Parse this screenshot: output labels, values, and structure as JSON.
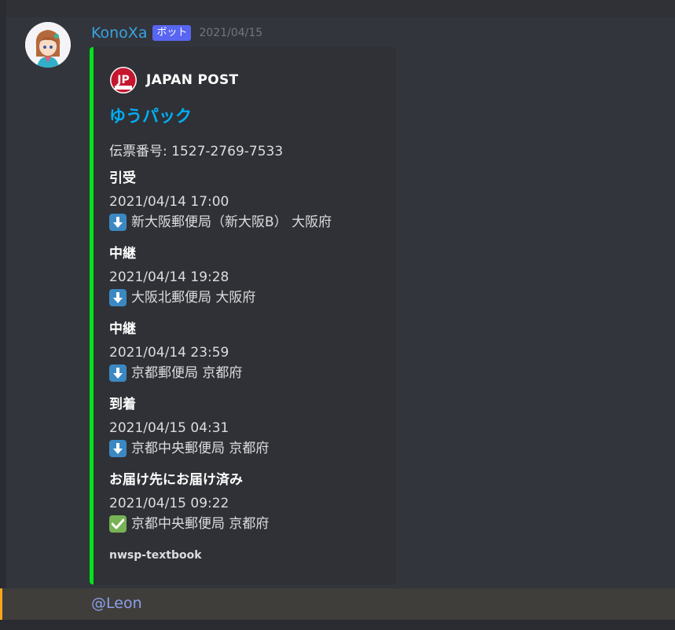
{
  "message": {
    "username": "KonoXa",
    "bot_tag": "ボット",
    "timestamp": "2021/04/15"
  },
  "embed": {
    "accent_color": "#00e41a",
    "author": "JAPAN POST",
    "author_logo_text": "JP",
    "title": "ゆうパック",
    "tracking_line": "伝票番号: 1527-2769-7533",
    "events": [
      {
        "status": "引受",
        "time": "2021/04/14 17:00",
        "icon": "down-arrow-emoji",
        "place": "新大阪郵便局（新大阪B） 大阪府"
      },
      {
        "status": "中継",
        "time": "2021/04/14 19:28",
        "icon": "down-arrow-emoji",
        "place": "大阪北郵便局 大阪府"
      },
      {
        "status": "中継",
        "time": "2021/04/14 23:59",
        "icon": "down-arrow-emoji",
        "place": "京都郵便局 京都府"
      },
      {
        "status": "到着",
        "time": "2021/04/15 04:31",
        "icon": "down-arrow-emoji",
        "place": "京都中央郵便局 京都府"
      },
      {
        "status": "お届け先にお届け済み",
        "time": "2021/04/15 09:22",
        "icon": "check-mark-emoji",
        "place": "京都中央郵便局 京都府"
      }
    ],
    "footer": "nwsp-textbook"
  },
  "reply": {
    "mention": "@Leon",
    "highlight_color": "#faa61a"
  }
}
